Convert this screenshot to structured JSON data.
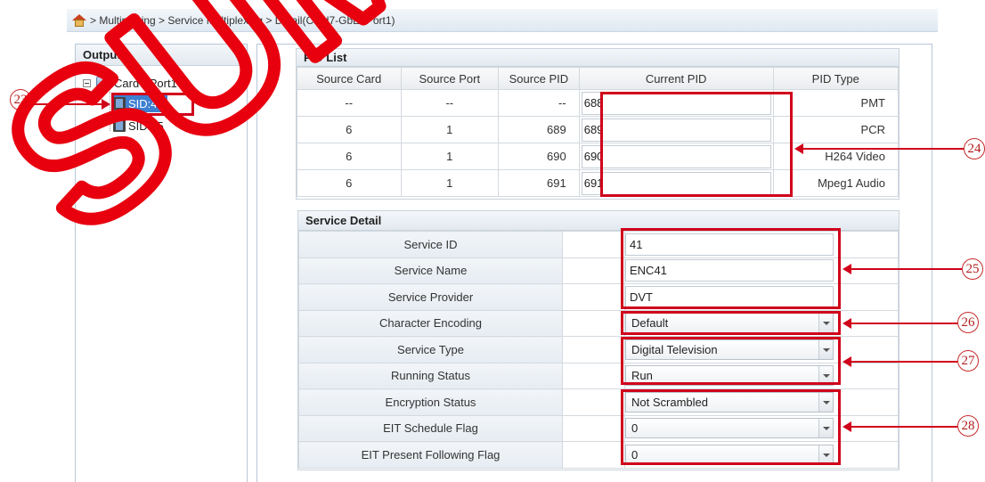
{
  "breadcrumb": {
    "icon": "home-icon",
    "text": "> Multiplexing > Service Multiplexing > Detail(Card7-GbE1Port1)"
  },
  "output": {
    "title": "Output",
    "root": "Card7-Port1",
    "items": [
      {
        "label": "SID:41",
        "selected": true
      },
      {
        "label": "SID:45",
        "selected": false
      }
    ]
  },
  "pid_list": {
    "title": "PID List",
    "columns": [
      "Source Card",
      "Source Port",
      "Source PID",
      "Current PID",
      "PID Type"
    ],
    "rows": [
      {
        "source_card": "--",
        "source_port": "--",
        "source_pid": "--",
        "current_pid": "688",
        "pid_type": "PMT"
      },
      {
        "source_card": "6",
        "source_port": "1",
        "source_pid": "689",
        "current_pid": "689",
        "pid_type": "PCR"
      },
      {
        "source_card": "6",
        "source_port": "1",
        "source_pid": "690",
        "current_pid": "690",
        "pid_type": "H264 Video"
      },
      {
        "source_card": "6",
        "source_port": "1",
        "source_pid": "691",
        "current_pid": "691",
        "pid_type": "Mpeg1 Audio"
      }
    ]
  },
  "service_detail": {
    "title": "Service Detail",
    "fields": [
      {
        "label": "Service ID",
        "value": "41",
        "kind": "input"
      },
      {
        "label": "Service Name",
        "value": "ENC41",
        "kind": "input"
      },
      {
        "label": "Service Provider",
        "value": "DVT",
        "kind": "input"
      },
      {
        "label": "Character Encoding",
        "value": "Default",
        "kind": "select"
      },
      {
        "label": "Service Type",
        "value": "Digital Television",
        "kind": "select"
      },
      {
        "label": "Running Status",
        "value": "Run",
        "kind": "select"
      },
      {
        "label": "Encryption Status",
        "value": "Not Scrambled",
        "kind": "select"
      },
      {
        "label": "EIT Schedule Flag",
        "value": "0",
        "kind": "select"
      },
      {
        "label": "EIT Present Following Flag",
        "value": "0",
        "kind": "select"
      }
    ]
  },
  "callouts": [
    "23",
    "24",
    "25",
    "26",
    "27",
    "28"
  ],
  "watermark": {
    "text": "SUMMA",
    "color": "#e8000f"
  },
  "colors": {
    "annotation": "#d0021b",
    "selection": "#3d7fd1"
  }
}
